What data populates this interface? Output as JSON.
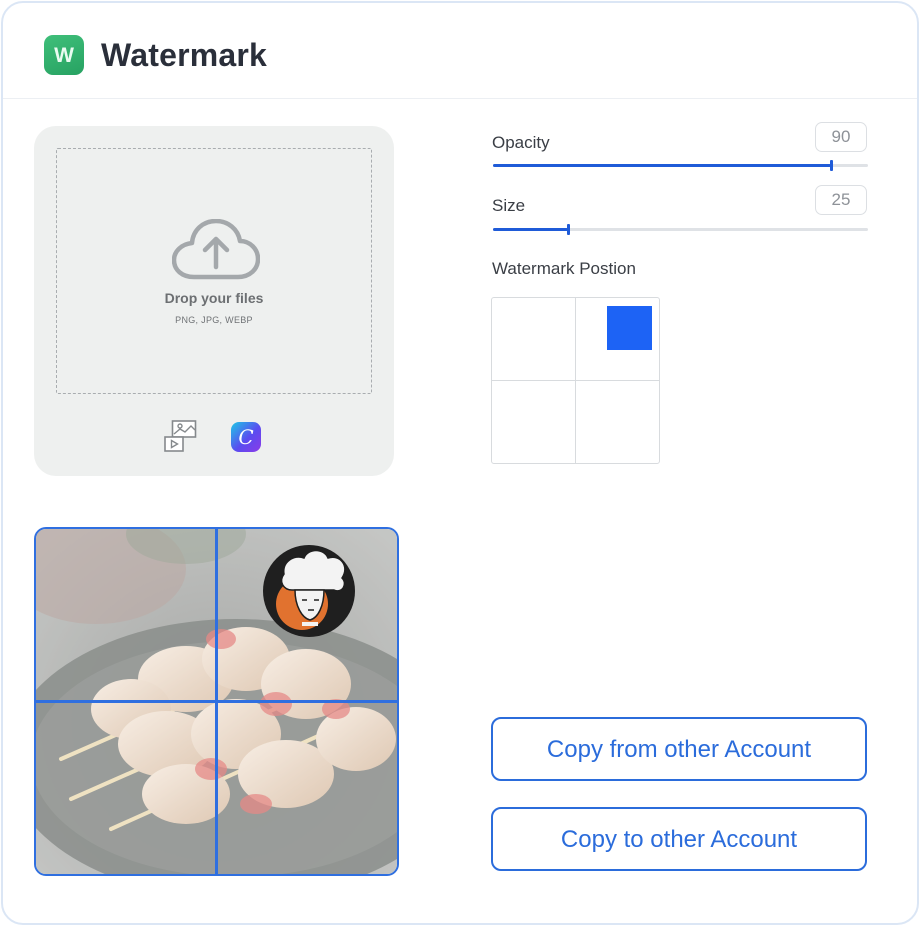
{
  "header": {
    "title": "Watermark",
    "logo_letter": "W"
  },
  "upload": {
    "title": "Drop your files",
    "formats": "PNG, JPG, WEBP",
    "icons": [
      "cloud-upload-icon",
      "media-library-icon",
      "canva-icon"
    ],
    "canva_letter": "C"
  },
  "controls": {
    "opacity": {
      "label": "Opacity",
      "value": "90",
      "fraction": 0.9
    },
    "size": {
      "label": "Size",
      "value": "25",
      "fraction": 0.2
    },
    "position_label": "Watermark Postion",
    "selected_position": "top-right"
  },
  "buttons": {
    "copy_from": "Copy from other Account",
    "copy_to": "Copy to other Account"
  },
  "colors": {
    "accent": "#2b6cdb",
    "brand_green": "#2faa6b",
    "marker": "#1d63f5"
  }
}
